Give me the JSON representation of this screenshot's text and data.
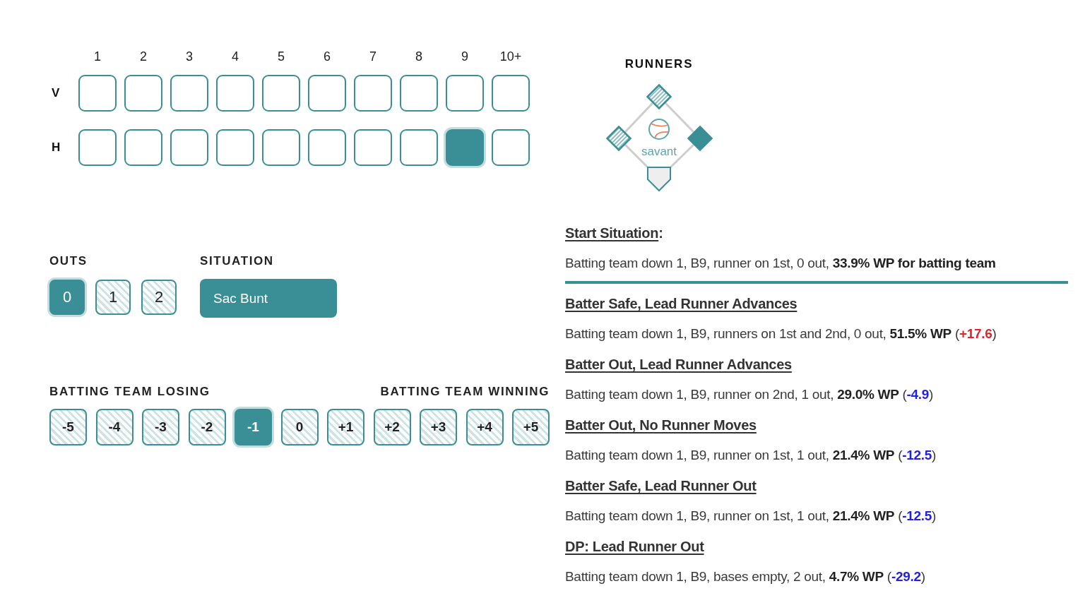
{
  "innings": {
    "columns": [
      "1",
      "2",
      "3",
      "4",
      "5",
      "6",
      "7",
      "8",
      "9",
      "10+"
    ],
    "rows": [
      {
        "label": "V",
        "cells": [
          {
            "selected": false
          },
          {
            "selected": false
          },
          {
            "selected": false
          },
          {
            "selected": false
          },
          {
            "selected": false
          },
          {
            "selected": false
          },
          {
            "selected": false
          },
          {
            "selected": false
          },
          {
            "selected": false
          },
          {
            "selected": false
          }
        ]
      },
      {
        "label": "H",
        "cells": [
          {
            "selected": false
          },
          {
            "selected": false
          },
          {
            "selected": false
          },
          {
            "selected": false
          },
          {
            "selected": false
          },
          {
            "selected": false
          },
          {
            "selected": false
          },
          {
            "selected": false
          },
          {
            "selected": true
          },
          {
            "selected": false
          }
        ]
      }
    ]
  },
  "runners": {
    "title": "RUNNERS",
    "logo": "savant",
    "bases": [
      {
        "occupied": true
      },
      {
        "occupied": false
      },
      {
        "occupied": false
      }
    ]
  },
  "outs": {
    "label": "OUTS",
    "options": [
      {
        "label": "0",
        "selected": true
      },
      {
        "label": "1",
        "selected": false
      },
      {
        "label": "2",
        "selected": false
      }
    ]
  },
  "situation": {
    "label": "SITUATION",
    "value": "Sac Bunt"
  },
  "score_differential": {
    "losing_label": "BATTING TEAM LOSING",
    "winning_label": "BATTING TEAM WINNING",
    "options": [
      {
        "label": "-5",
        "selected": false
      },
      {
        "label": "-4",
        "selected": false
      },
      {
        "label": "-3",
        "selected": false
      },
      {
        "label": "-2",
        "selected": false
      },
      {
        "label": "-1",
        "selected": true
      },
      {
        "label": "0",
        "selected": false
      },
      {
        "label": "+1",
        "selected": false
      },
      {
        "label": "+2",
        "selected": false
      },
      {
        "label": "+3",
        "selected": false
      },
      {
        "label": "+4",
        "selected": false
      },
      {
        "label": "+5",
        "selected": false
      }
    ]
  },
  "start_situation": {
    "title": "Start Situation",
    "punctuation": ":",
    "description": "Batting team down 1, B9, runner on 1st, 0 out, **33.9% WP for batting team**"
  },
  "outcomes": [
    {
      "title": "Batter Safe, Lead Runner Advances",
      "description": "Batting team down 1, B9, runners on 1st and 2nd, 0 out, **51.5% WP** (",
      "delta": "+17.6",
      "color": "#e3222b",
      "close": ")"
    },
    {
      "title": "Batter Out, Lead Runner Advances",
      "description": "Batting team down 1, B9, runner on 2nd, 1 out, **29.0% WP** (",
      "delta": "-4.9",
      "color": "#1f1fe6",
      "close": ")"
    },
    {
      "title": "Batter Out, No Runner Moves",
      "description": "Batting team down 1, B9, runner on 1st, 1 out, **21.4% WP** (",
      "delta": "-12.5",
      "color": "#1f1fe6",
      "close": ")"
    },
    {
      "title": "Batter Safe, Lead Runner Out",
      "description": "Batting team down 1, B9, runner on 1st, 1 out, **21.4% WP** (",
      "delta": "-12.5",
      "color": "#1f1fe6",
      "close": ")"
    },
    {
      "title": "DP: Lead Runner Out",
      "description": "Batting team down 1, B9, bases empty, 2 out, **4.7% WP** (",
      "delta": "-29.2",
      "color": "#1f1fe6",
      "close": ")"
    }
  ]
}
